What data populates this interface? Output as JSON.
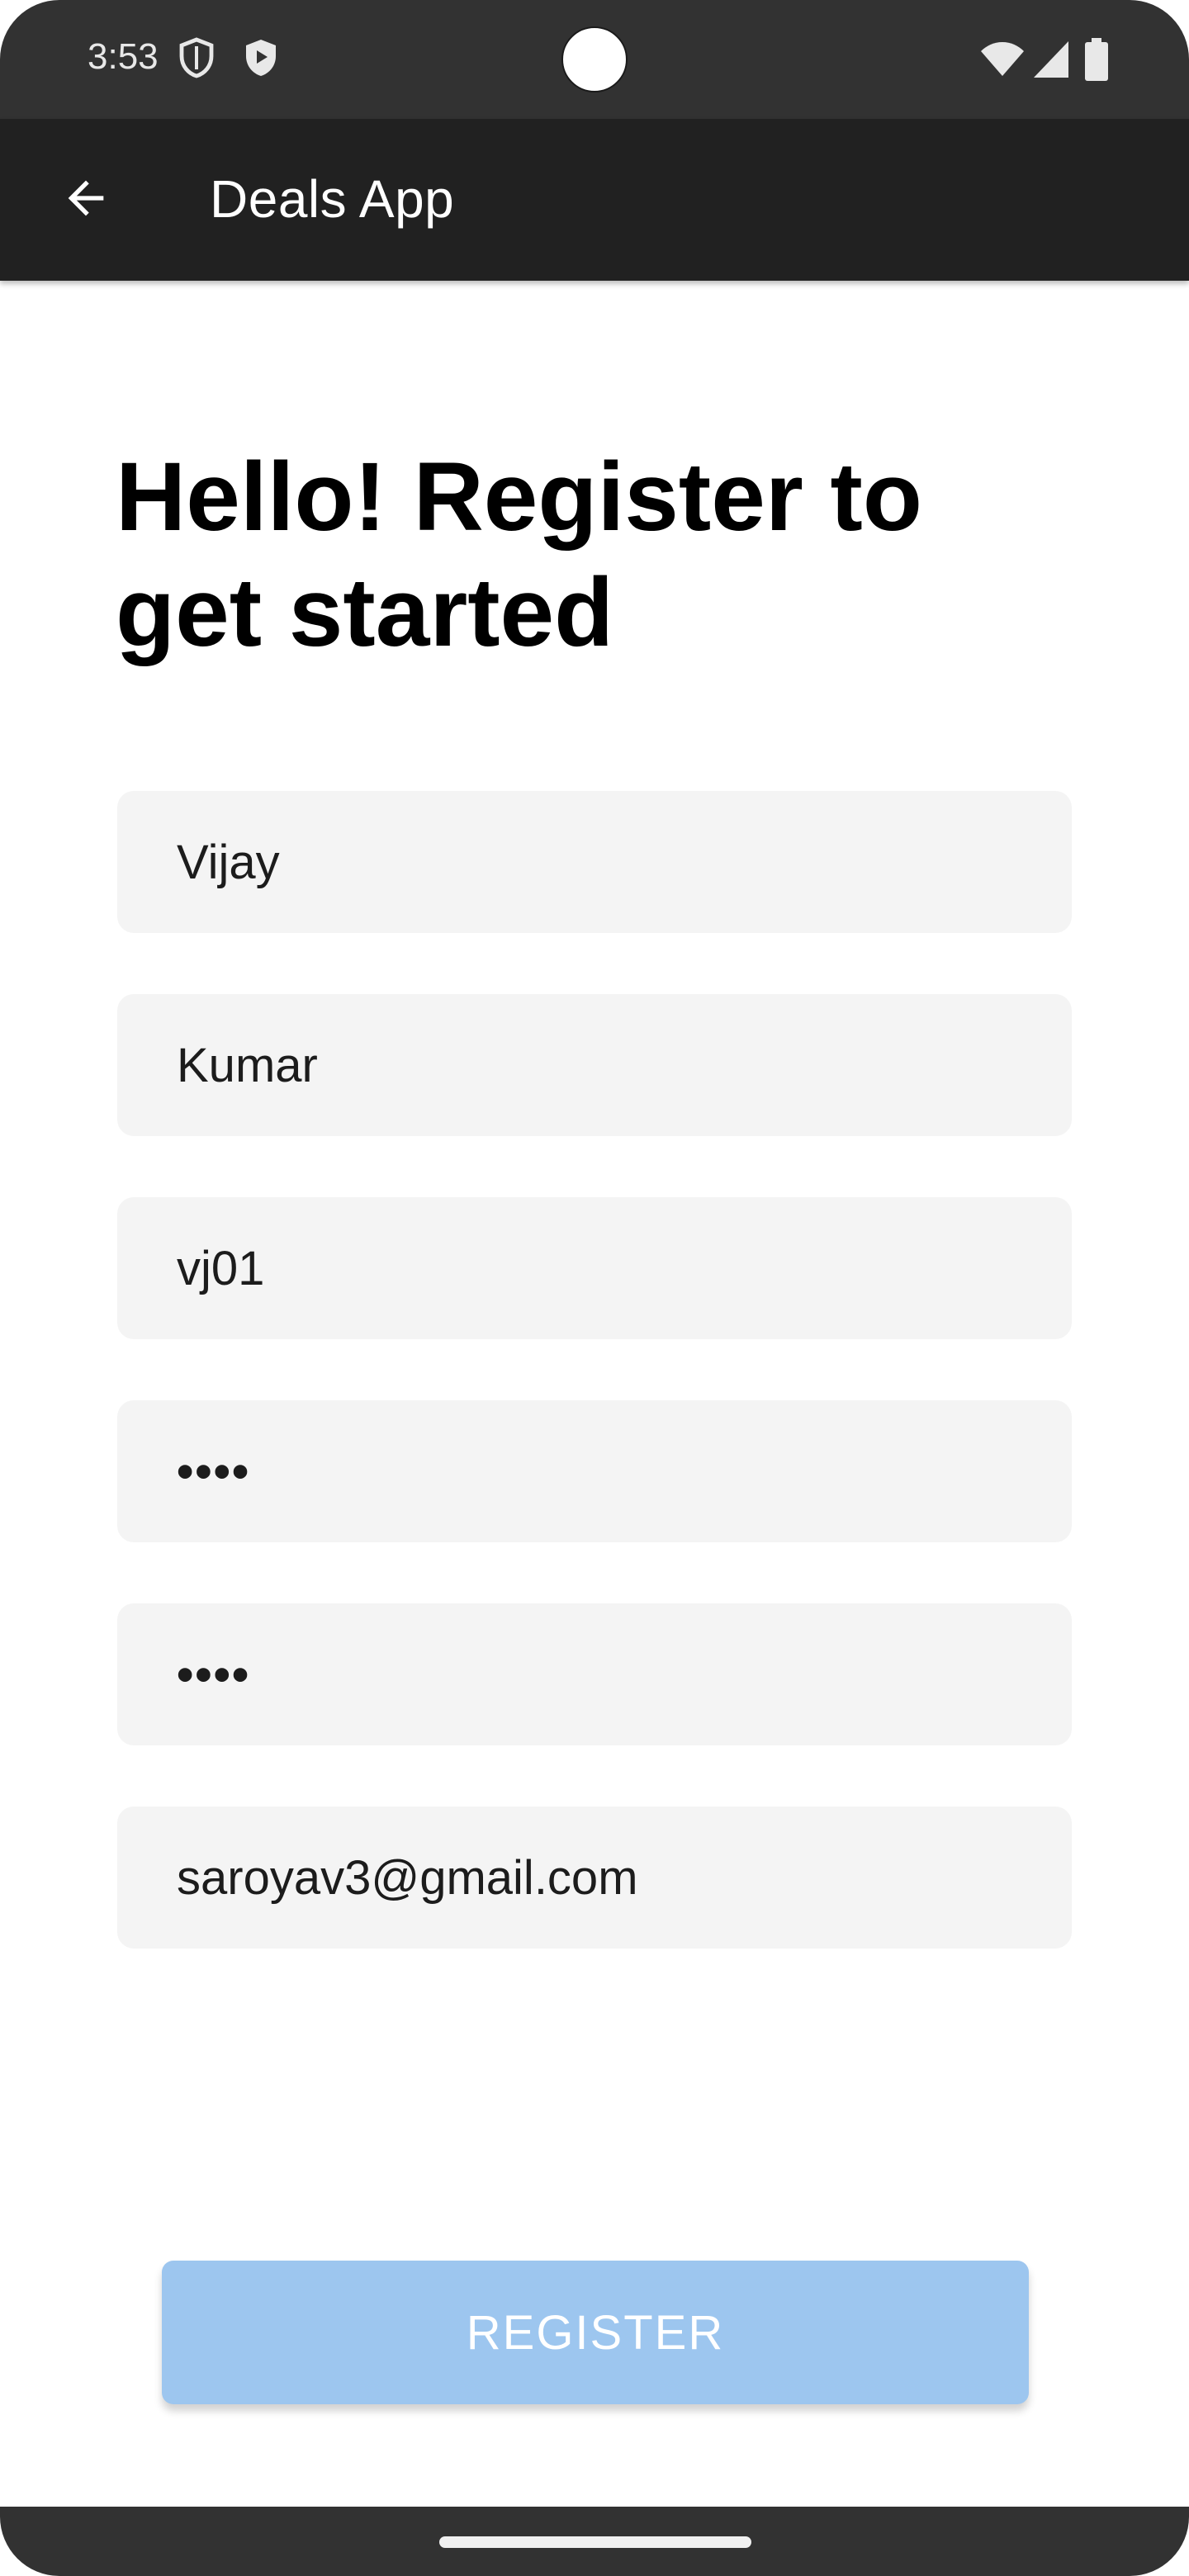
{
  "status_bar": {
    "time": "3:53",
    "icons": [
      "shield-outline-icon",
      "play-shield-icon",
      "wifi-icon",
      "signal-icon",
      "battery-icon"
    ]
  },
  "app_bar": {
    "title": "Deals App",
    "back_icon": "arrow-left-icon"
  },
  "main": {
    "heading": "Hello! Register to get started",
    "fields": [
      {
        "name": "first-name-field",
        "value": "Vijay"
      },
      {
        "name": "last-name-field",
        "value": "Kumar"
      },
      {
        "name": "username-field",
        "value": "vj01"
      },
      {
        "name": "password-field",
        "value": "••••"
      },
      {
        "name": "confirm-password-field",
        "value": "••••"
      },
      {
        "name": "email-field",
        "value": "saroyav3@gmail.com"
      }
    ],
    "register_label": "REGISTER"
  },
  "colors": {
    "status_bar_bg": "#323232",
    "app_bar_bg": "#212121",
    "field_bg": "#f4f4f4",
    "button_bg": "#9dc6ef"
  }
}
